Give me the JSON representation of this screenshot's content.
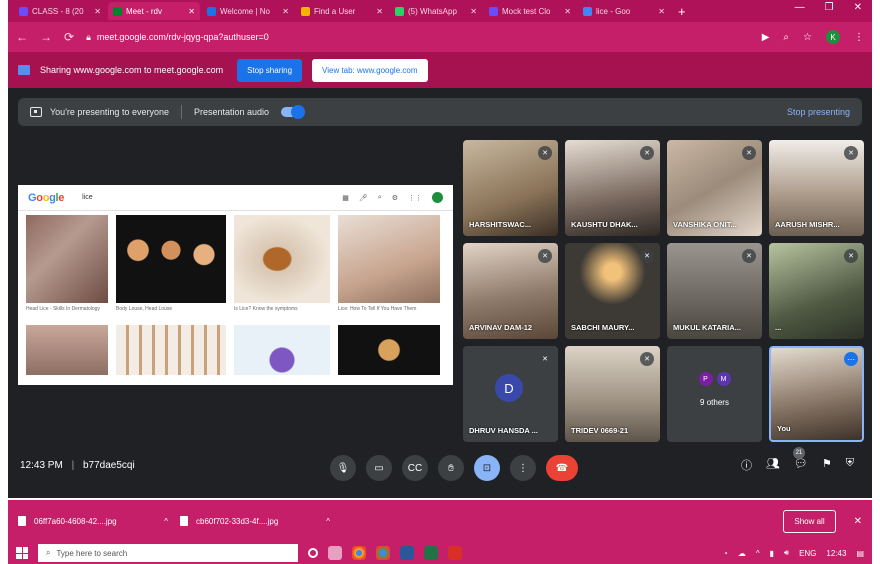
{
  "browser": {
    "tabs": [
      {
        "label": "CLASS - 8 (20",
        "color": "#6a4cff"
      },
      {
        "label": "Meet - rdv",
        "color": "#00832d",
        "active": true
      },
      {
        "label": "Welcome | No",
        "color": "#1a73e8"
      },
      {
        "label": "Find a User",
        "color": "#f4b400"
      },
      {
        "label": "(5) WhatsApp",
        "color": "#25d366"
      },
      {
        "label": "Mock test Clo",
        "color": "#6a4cff"
      },
      {
        "label": "lice - Goo",
        "color": "#4285f4"
      }
    ],
    "url": "meet.google.com/rdv-jqyg-qpa?authuser=0",
    "profile_initial": "K"
  },
  "sharebar": {
    "text": "Sharing www.google.com to meet.google.com",
    "stop_label": "Stop sharing",
    "view_label": "View tab: www.google.com"
  },
  "presenting": {
    "text": "You're presenting to everyone",
    "audio_label": "Presentation audio",
    "stop_label": "Stop presenting"
  },
  "shared_screen": {
    "query": "lice",
    "captions": [
      "Head Lice - Skills In Dermatology",
      "Body Louse, Head Louse",
      "Is Lice? Know the symptoms",
      "Lice: How To Tell If You Have Them"
    ]
  },
  "participants": [
    {
      "name": "HARSHITSWAC...",
      "color": "#8a7358"
    },
    {
      "name": "KAUSHTU DHAK...",
      "color": "#7a6a60"
    },
    {
      "name": "VANSHIKA ONIT...",
      "color": "#9c8b7a"
    },
    {
      "name": "AARUSH MISHR...",
      "color": "#a89786"
    },
    {
      "name": "ARVINAV DAM-12",
      "color": "#8f7b6b"
    },
    {
      "name": "SABCHI MAURY...",
      "color": "#3d3a35"
    },
    {
      "name": "MUKUL KATARIA...",
      "color": "#6b665f"
    },
    {
      "name": "...",
      "color": "#515a44"
    }
  ],
  "participants_row3": {
    "dhruv": {
      "name": "DHRUV HANSDA ...",
      "initial": "D"
    },
    "tridev": {
      "name": "TRIDEV 0669-21"
    },
    "others": {
      "label": "9 others",
      "initials": [
        "P",
        "M"
      ]
    },
    "self": {
      "name": "You"
    }
  },
  "meeting": {
    "time": "12:43 PM",
    "code": "b77dae5cqi",
    "participant_count": "21"
  },
  "downloads": [
    {
      "name": "06ff7a60-4608-42....jpg"
    },
    {
      "name": "cb60f702-33d3-4f....jpg"
    }
  ],
  "downloads_show_all": "Show all",
  "taskbar": {
    "search_placeholder": "Type here to search",
    "lang": "ENG",
    "clock": "12:43"
  }
}
